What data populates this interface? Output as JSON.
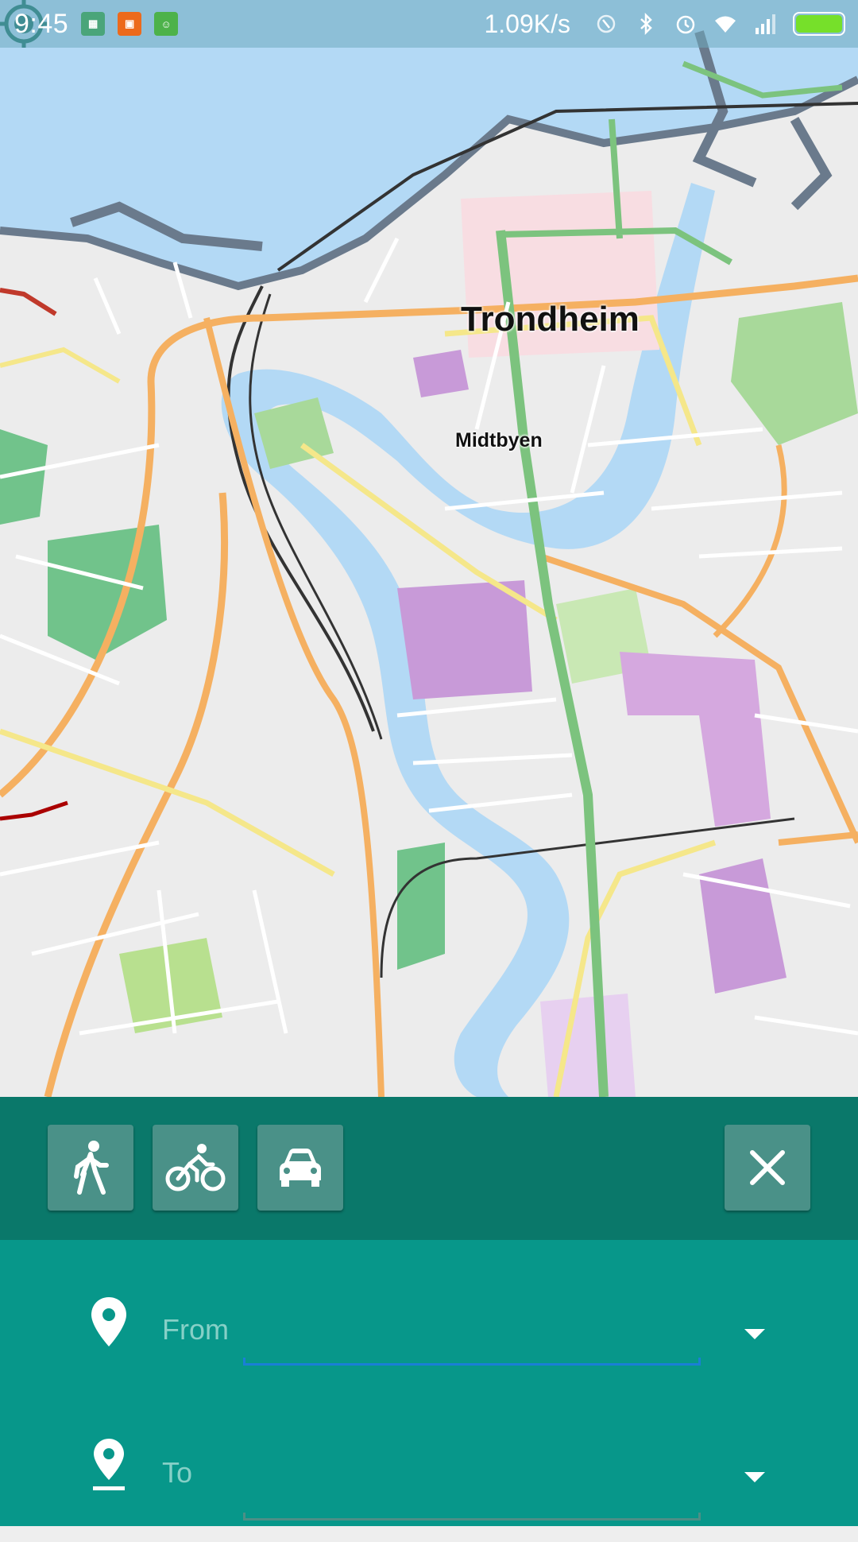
{
  "status_bar": {
    "time": "9:45",
    "net_speed": "1.09K/s",
    "battery_level": 1.0,
    "notification_icons": [
      "map-app-icon",
      "shop-app-icon",
      "android-app-icon"
    ],
    "system_icons": [
      "nfc-icon",
      "bluetooth-icon",
      "alarm-icon",
      "wifi-icon",
      "signal-icon",
      "battery-icon"
    ]
  },
  "map": {
    "city_label": "Trondheim",
    "district_label": "Midtbyen"
  },
  "route_modes": {
    "walk": "walk-icon",
    "bike": "bike-icon",
    "car": "car-icon",
    "close": "close-icon"
  },
  "route_form": {
    "from_placeholder": "From",
    "to_placeholder": "To"
  },
  "colors": {
    "toolbar": "#0a786a",
    "panel": "#07978a",
    "button": "#4a9188",
    "focus_underline": "#1a7fd6",
    "water": "#b3d9f5",
    "park": "#71c38b",
    "main_road": "#f5b061"
  }
}
